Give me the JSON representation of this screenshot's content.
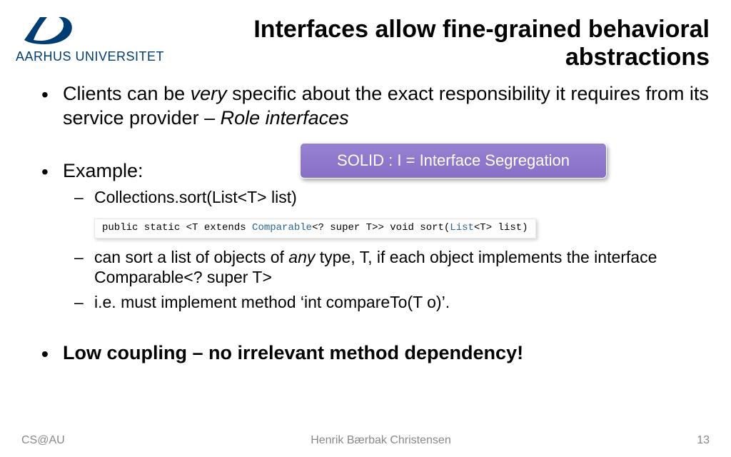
{
  "logo": {
    "text": "AARHUS UNIVERSITET"
  },
  "title": "Interfaces allow fine-grained behavioral abstractions",
  "bullets": {
    "b1_prefix": "Clients can be ",
    "b1_italic": "very",
    "b1_mid": " specific about the exact responsibility it requires from its service provider – ",
    "b1_italic2": "Role interfaces",
    "b2": "Example:",
    "b2_sub1": "Collections.sort(List<T> list)",
    "b2_sub2_prefix": "can sort a list of objects of ",
    "b2_sub2_italic": "any",
    "b2_sub2_suffix": " type, T, if each object implements the interface Comparable<? super T>",
    "b2_sub3": "i.e. must implement method ‘int compareTo(T o)’.",
    "b3": "Low coupling – no irrelevant method dependency!"
  },
  "solid_box": "SOLID : I = Interface Segregation",
  "code": {
    "t1": "public static <T extends ",
    "t2": "Comparable",
    "t3": "<? super T>> void sort(",
    "t4": "List",
    "t5": "<T> list)"
  },
  "footer": {
    "left": "CS@AU",
    "center": "Henrik Bærbak Christensen",
    "right": "13"
  }
}
